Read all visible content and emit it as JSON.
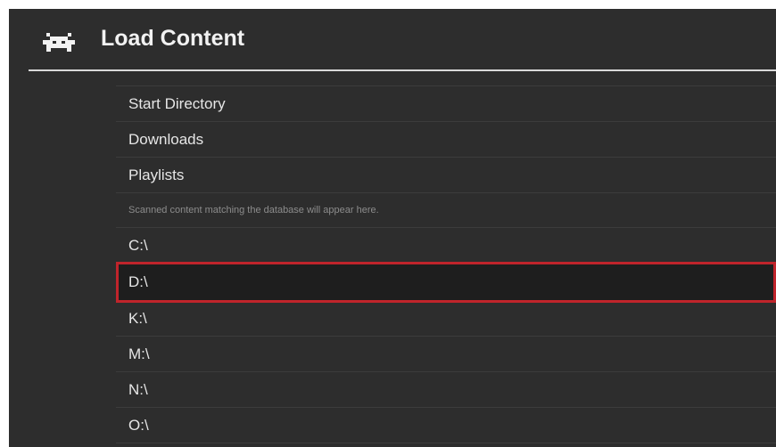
{
  "header": {
    "title": "Load Content",
    "icon": "retroarch-invader-icon"
  },
  "list": {
    "items": [
      {
        "label": "Start Directory",
        "type": "item"
      },
      {
        "label": "Downloads",
        "type": "item"
      },
      {
        "label": "Playlists",
        "type": "item"
      },
      {
        "label": "Scanned content matching the database will appear here.",
        "type": "info"
      },
      {
        "label": "C:\\",
        "type": "item"
      },
      {
        "label": "D:\\",
        "type": "item",
        "selected": true
      },
      {
        "label": "K:\\",
        "type": "item"
      },
      {
        "label": "M:\\",
        "type": "item"
      },
      {
        "label": "N:\\",
        "type": "item"
      },
      {
        "label": "O:\\",
        "type": "item"
      }
    ]
  },
  "colors": {
    "background": "#2d2d2d",
    "selection_border": "#c0242b",
    "text": "#e6e6e6"
  }
}
